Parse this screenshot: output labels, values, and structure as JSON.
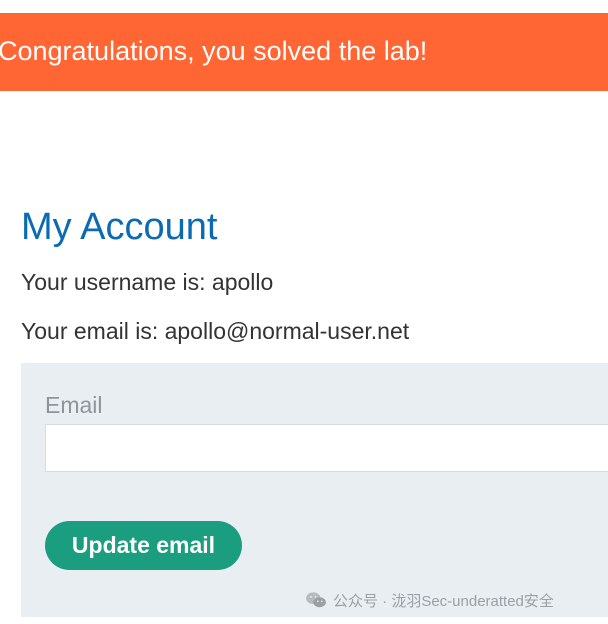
{
  "banner": {
    "text": "Congratulations, you solved the lab!",
    "color": "#ff6633"
  },
  "account": {
    "title": "My Account",
    "username_line": "Your username is: apollo",
    "email_line": "Your email is: apollo@normal-user.net"
  },
  "form": {
    "email_label": "Email",
    "email_value": "",
    "email_placeholder": "",
    "submit_label": "Update email",
    "button_color": "#1b9e80"
  },
  "watermark": {
    "icon": "wechat-icon",
    "text": "公众号 · 泷羽Sec-underatted安全"
  }
}
